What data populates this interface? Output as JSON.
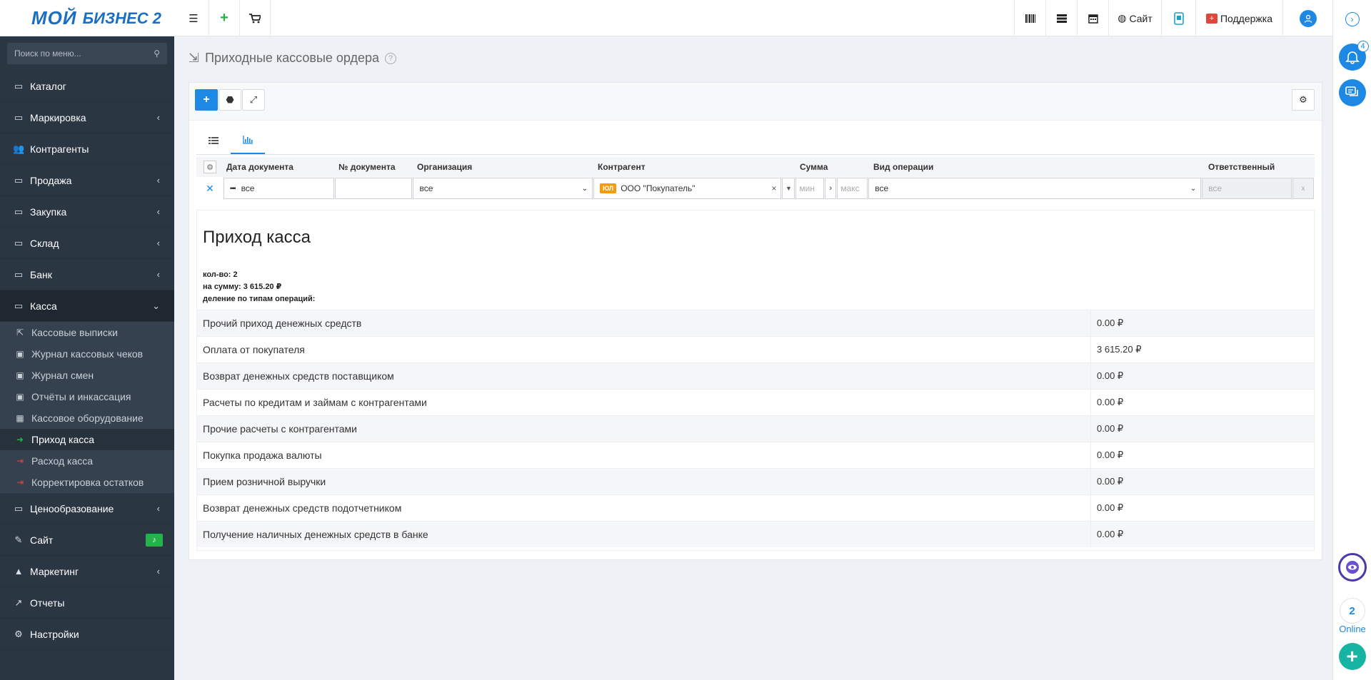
{
  "logo": {
    "line1": "МОЙ",
    "line2": "БИЗНЕС 2"
  },
  "topbar": {
    "menu_icon": "☰",
    "add_icon": "+",
    "cart_icon": "🛒",
    "site_label": "Сайт",
    "support_label": "Поддержка"
  },
  "sidebar": {
    "search_placeholder": "Поиск по меню...",
    "items": [
      {
        "label": "Каталог",
        "icon": "folder-icon",
        "chevron": ""
      },
      {
        "label": "Маркировка",
        "icon": "folder-icon",
        "chevron": "‹"
      },
      {
        "label": "Контрагенты",
        "icon": "users-icon",
        "chevron": ""
      },
      {
        "label": "Продажа",
        "icon": "folder-icon",
        "chevron": "‹"
      },
      {
        "label": "Закупка",
        "icon": "folder-icon",
        "chevron": "‹"
      },
      {
        "label": "Склад",
        "icon": "folder-icon",
        "chevron": "‹"
      },
      {
        "label": "Банк",
        "icon": "folder-icon",
        "chevron": "‹"
      },
      {
        "label": "Касса",
        "icon": "folder-icon",
        "chevron": "⌄"
      }
    ],
    "kassa_sub": [
      {
        "label": "Кассовые выписки",
        "icon": "export-icon"
      },
      {
        "label": "Журнал кассовых чеков",
        "icon": "money-icon"
      },
      {
        "label": "Журнал смен",
        "icon": "money-icon"
      },
      {
        "label": "Отчёты и инкассация",
        "icon": "money-icon"
      },
      {
        "label": "Кассовое оборудование",
        "icon": "calculator-icon"
      },
      {
        "label": "Приход касса",
        "icon": "sign-in-icon"
      },
      {
        "label": "Расход касса",
        "icon": "sign-out-icon"
      },
      {
        "label": "Корректировка остатков",
        "icon": "sign-out-icon"
      }
    ],
    "items_after": [
      {
        "label": "Ценообразование",
        "icon": "folder-icon",
        "chevron": "‹"
      },
      {
        "label": "Сайт",
        "icon": "magic-icon",
        "chevron": ""
      },
      {
        "label": "Маркетинг",
        "icon": "chart-area-icon",
        "chevron": "‹"
      },
      {
        "label": "Отчеты",
        "icon": "line-chart-icon",
        "chevron": ""
      },
      {
        "label": "Настройки",
        "icon": "gear-icon",
        "chevron": ""
      }
    ]
  },
  "page": {
    "title": "Приходные кассовые ордера"
  },
  "filters": {
    "headers": [
      "Дата документа",
      "№ документа",
      "Организация",
      "Контрагент",
      "Сумма",
      "Вид операции",
      "Ответственный"
    ],
    "date_value": "все",
    "doc_number_value": "",
    "organization_value": "все",
    "contractor_tag": "ЮЛ",
    "contractor_value": "ООО \"Покупатель\"",
    "sum_min_placeholder": "мин",
    "sum_max_placeholder": "макс",
    "operation_value": "все",
    "responsible_value": "все"
  },
  "report": {
    "title": "Приход касса",
    "count_line": "кол-во: 2",
    "sum_line": "на сумму: 3 615.20 ₽",
    "split_line": "деление по типам операций:",
    "rows": [
      {
        "label": "Прочий приход денежных средств",
        "value": "0.00 ₽"
      },
      {
        "label": "Оплата от покупателя",
        "value": "3 615.20 ₽"
      },
      {
        "label": "Возврат денежных средств поставщиком",
        "value": "0.00 ₽"
      },
      {
        "label": "Расчеты по кредитам и займам с контрагентами",
        "value": "0.00 ₽"
      },
      {
        "label": "Прочие расчеты с контрагентами",
        "value": "0.00 ₽"
      },
      {
        "label": "Покупка продажа валюты",
        "value": "0.00 ₽"
      },
      {
        "label": "Прием розничной выручки",
        "value": "0.00 ₽"
      },
      {
        "label": "Возврат денежных средств подотчетником",
        "value": "0.00 ₽"
      },
      {
        "label": "Получение наличных денежных средств в банке",
        "value": "0.00 ₽"
      }
    ]
  },
  "rail": {
    "notif_count": "4",
    "online_count": "2",
    "online_label": "Online"
  },
  "colors": {
    "accent": "#1e88e5",
    "sidebar": "#2b3643",
    "success": "#27b14a",
    "warning": "#f39c12",
    "danger": "#e0463c"
  }
}
